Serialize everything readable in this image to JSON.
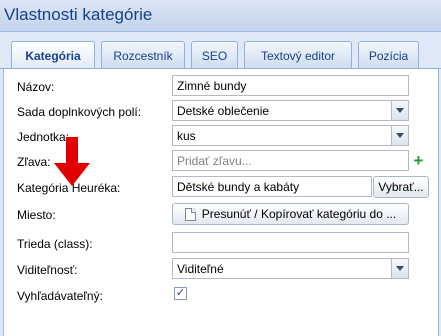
{
  "window": {
    "title": "Vlastnosti kategórie"
  },
  "tabs": [
    {
      "label": "Kategória",
      "active": true
    },
    {
      "label": "Rozcestník",
      "active": false
    },
    {
      "label": "SEO",
      "active": false
    },
    {
      "label": "Textový editor",
      "active": false
    },
    {
      "label": "Pozícia",
      "active": false
    }
  ],
  "form": {
    "nazov": {
      "label": "Názov:",
      "value": "Zimné bundy"
    },
    "sada": {
      "label": "Sada doplnkových polí:",
      "value": "Detské oblečenie"
    },
    "jednotka": {
      "label": "Jednotka:",
      "value": "kus"
    },
    "zlava": {
      "label": "Zľava:",
      "placeholder": "Pridať zľavu..."
    },
    "heureka": {
      "label": "Kategória Heuréka:",
      "value": "Dětské bundy a kabáty",
      "button": "Vybrať..."
    },
    "miesto": {
      "label": "Miesto:",
      "button": "Presunúť / Kopírovať kategóriu do ..."
    },
    "trieda": {
      "label": "Trieda (class):",
      "value": ""
    },
    "viditelnost": {
      "label": "Viditeľnosť:",
      "value": "Viditeľné"
    },
    "vyhladavatelny": {
      "label": "Vyhľadávateľný:",
      "checked": true
    }
  },
  "icons": {
    "add": "plus-icon",
    "dropdown": "chevron-down-icon",
    "document": "document-icon",
    "check": "check-icon",
    "annotation": "red-arrow-icon"
  },
  "colors": {
    "title": "#15428b",
    "panel_border": "#99bbe8",
    "annotation_arrow": "#e00000",
    "add_icon": "#2a9a2a"
  }
}
